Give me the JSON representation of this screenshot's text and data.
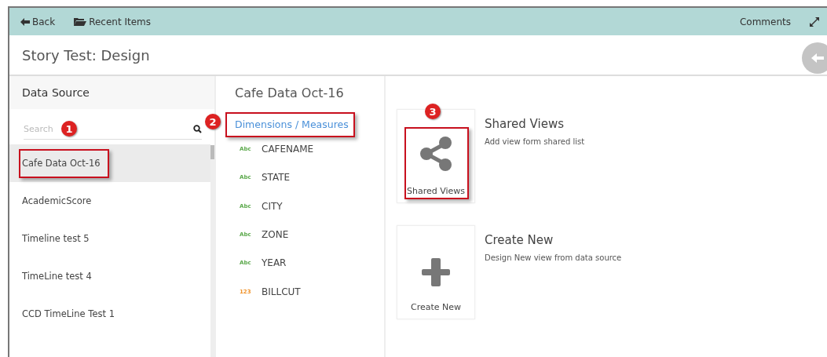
{
  "toolbar": {
    "back": "Back",
    "recent": "Recent Items",
    "comments": "Comments"
  },
  "title": "Story Test: Design",
  "data_source": {
    "heading": "Data Source",
    "search": {
      "placeholder": "Search"
    },
    "items": [
      {
        "label": "Cafe Data Oct-16",
        "selected": true,
        "callout": "1"
      },
      {
        "label": "AcademicScore",
        "selected": false
      },
      {
        "label": "Timeline test 5",
        "selected": false
      },
      {
        "label": "TimeLine test 4",
        "selected": false
      },
      {
        "label": "CCD TimeLine Test 1",
        "selected": false
      }
    ]
  },
  "fields": {
    "heading": "Cafe Data Oct-16",
    "tab": "Dimensions / Measures",
    "tab_callout": "2",
    "items": [
      {
        "kind": "text",
        "type_label": "Abc",
        "name": "CAFENAME"
      },
      {
        "kind": "text",
        "type_label": "Abc",
        "name": "STATE"
      },
      {
        "kind": "text",
        "type_label": "Abc",
        "name": "CITY"
      },
      {
        "kind": "text",
        "type_label": "Abc",
        "name": "ZONE"
      },
      {
        "kind": "text",
        "type_label": "Abc",
        "name": "YEAR"
      },
      {
        "kind": "number",
        "type_label": "123",
        "name": "BILLCUT"
      }
    ]
  },
  "options": [
    {
      "kind": "share",
      "label": "Shared Views",
      "title": "Shared Views",
      "description": "Add view form shared list",
      "callout": "3"
    },
    {
      "kind": "create",
      "label": "Create New",
      "title": "Create New",
      "description": "Design New view from data source"
    }
  ]
}
